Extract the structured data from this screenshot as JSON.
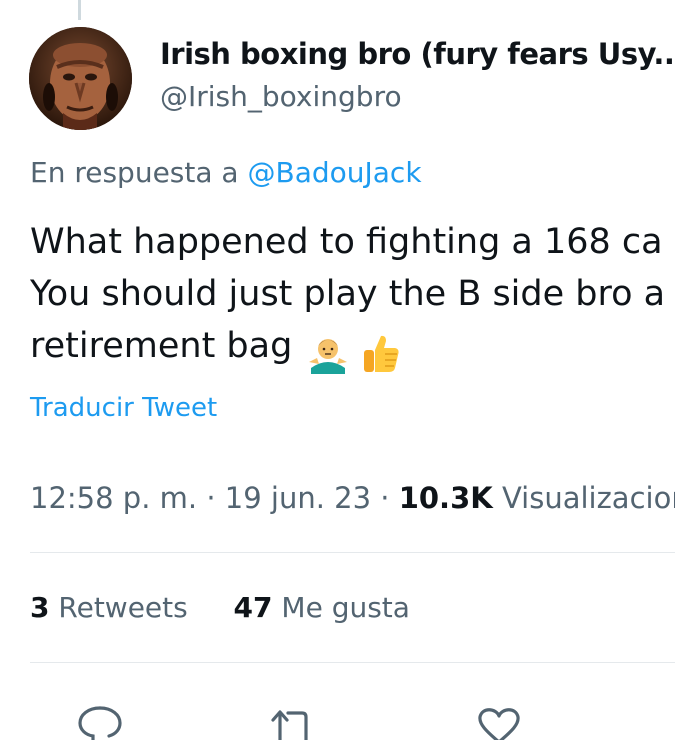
{
  "author": {
    "display_name": "Irish boxing bro (fury fears Usy...",
    "handle": "@Irish_boxingbro"
  },
  "reply": {
    "prefix": "En respuesta a",
    "mention": "@BadouJack"
  },
  "tweet": {
    "lines": [
      "What happened to fighting a 168 ca",
      "You should just play the B side bro a",
      "retirement bag"
    ],
    "emojis": [
      "person-shrugging-emoji",
      "thumbs-up-emoji"
    ]
  },
  "translate_label": "Traducir Tweet",
  "meta": {
    "time": "12:58 p. m.",
    "separator": "·",
    "date": "19 jun. 23",
    "views_count": "10.3K",
    "views_label": "Visualizacione"
  },
  "stats": {
    "retweets_count": "3",
    "retweets_label": "Retweets",
    "likes_count": "47",
    "likes_label": "Me gusta"
  },
  "actions": [
    "reply-icon",
    "retweet-icon",
    "like-icon"
  ],
  "colors": {
    "link": "#1d9bf0",
    "secondary_text": "#536471",
    "primary_text": "#0f1419",
    "divider": "#e5e9ec"
  }
}
